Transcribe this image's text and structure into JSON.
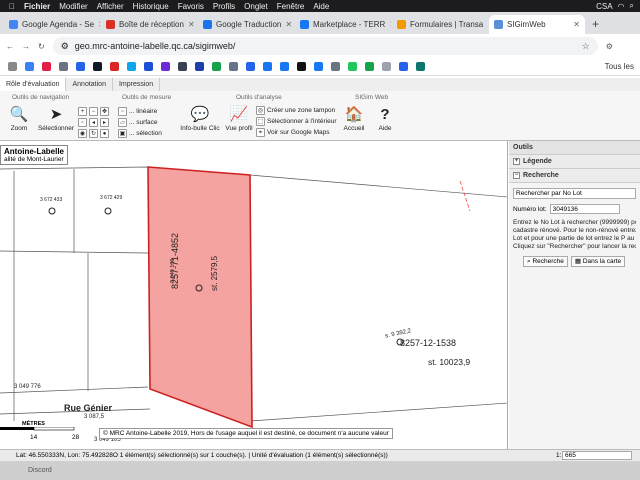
{
  "mac_menu": [
    "Fichier",
    "Modifier",
    "Afficher",
    "Historique",
    "Favoris",
    "Profils",
    "Onglet",
    "Fenêtre",
    "Aide"
  ],
  "mac_status": {
    "battery": "CSA"
  },
  "browser_tabs": [
    {
      "label": "Google Agenda - Se",
      "color": "#4285f4"
    },
    {
      "label": "Boîte de réception",
      "color": "#d93025"
    },
    {
      "label": "Google Traduction",
      "color": "#1a73e8"
    },
    {
      "label": "Marketplace - TERR",
      "color": "#1877f2"
    },
    {
      "label": "Formulaires | Transa",
      "color": "#f29900"
    },
    {
      "label": "SIGimWeb",
      "color": "#5b8fd6"
    }
  ],
  "url": "geo.mrc-antoine-labelle.qc.ca/sigimweb/",
  "bookmarks_all": "Tous les",
  "app_tabs": [
    "Rôle d'évaluation",
    "Annotation",
    "Impression"
  ],
  "ribbon": {
    "nav_group": "Outils de navigation",
    "zoom": "Zoom",
    "select": "Sélectionner",
    "measure_group": "Outils de mesure",
    "linear": "... linéaire",
    "surface": "... surface",
    "selection": "... sélection",
    "analysis_group": "Outils d'analyse",
    "tooltip": "Info-bulle Clic",
    "profile": "Vue profil",
    "buffer": "Créer une zone tampon",
    "select_inside": "Sélectionner à l'intérieur",
    "google_maps": "Voir sur Google Maps",
    "sigim_group": "SIGim Web",
    "home": "Accueil",
    "help": "Aide"
  },
  "map": {
    "title": "Antoine-Labelle",
    "subtitle": "alité de Mont-Laurier",
    "lot_main": "8257-71-4852",
    "lot_main_id": "3 049 136",
    "lot_main_area": "st. 2579,5",
    "lot_right": "8257-12-1538",
    "lot_right_area": "st. 10023,9",
    "lot_right_side": "s. 9 392,2",
    "lot_776": "3 049 776",
    "lot_105": "3 049 105",
    "lot_bottom": "3 087,5",
    "lot_a": "3 672 433",
    "lot_b": "3 672 429",
    "street": "Rue Génier",
    "scale_title": "MÈTRES",
    "scale_14": "14",
    "scale_28": "28",
    "copyright": "© MRC Antoine-Labelle 2019, Hors de l'usage auquel il est destiné, ce document n'a aucune valeur"
  },
  "panel": {
    "header": "Outils",
    "legend": "Légende",
    "search": "Recherche",
    "search_by": "Rechercher par No Lot",
    "lot_label": "Numéro lot:",
    "lot_value": "3049136",
    "help_lines": [
      "Entrez le No Lot à rechercher (9999999) pou",
      "cadastre rénové. Pour le non-rénové entrez l",
      "Lot et pour une partie de lot entrez le P au d",
      "Cliquez sur \"Rechercher\" pour lancer la reche"
    ],
    "btn_search": "Recherche",
    "btn_map": "Dans la carte"
  },
  "status": {
    "text": "Lat: 46.550333N, Lon: 75.492828O   1 élément(s) sélectionné(s) sur 1 couche(s).  |  Unité d'évaluation (1 élément(s) sélectionné(s))",
    "page": "1:",
    "scale_value": "665"
  },
  "dock_text": "Discord"
}
